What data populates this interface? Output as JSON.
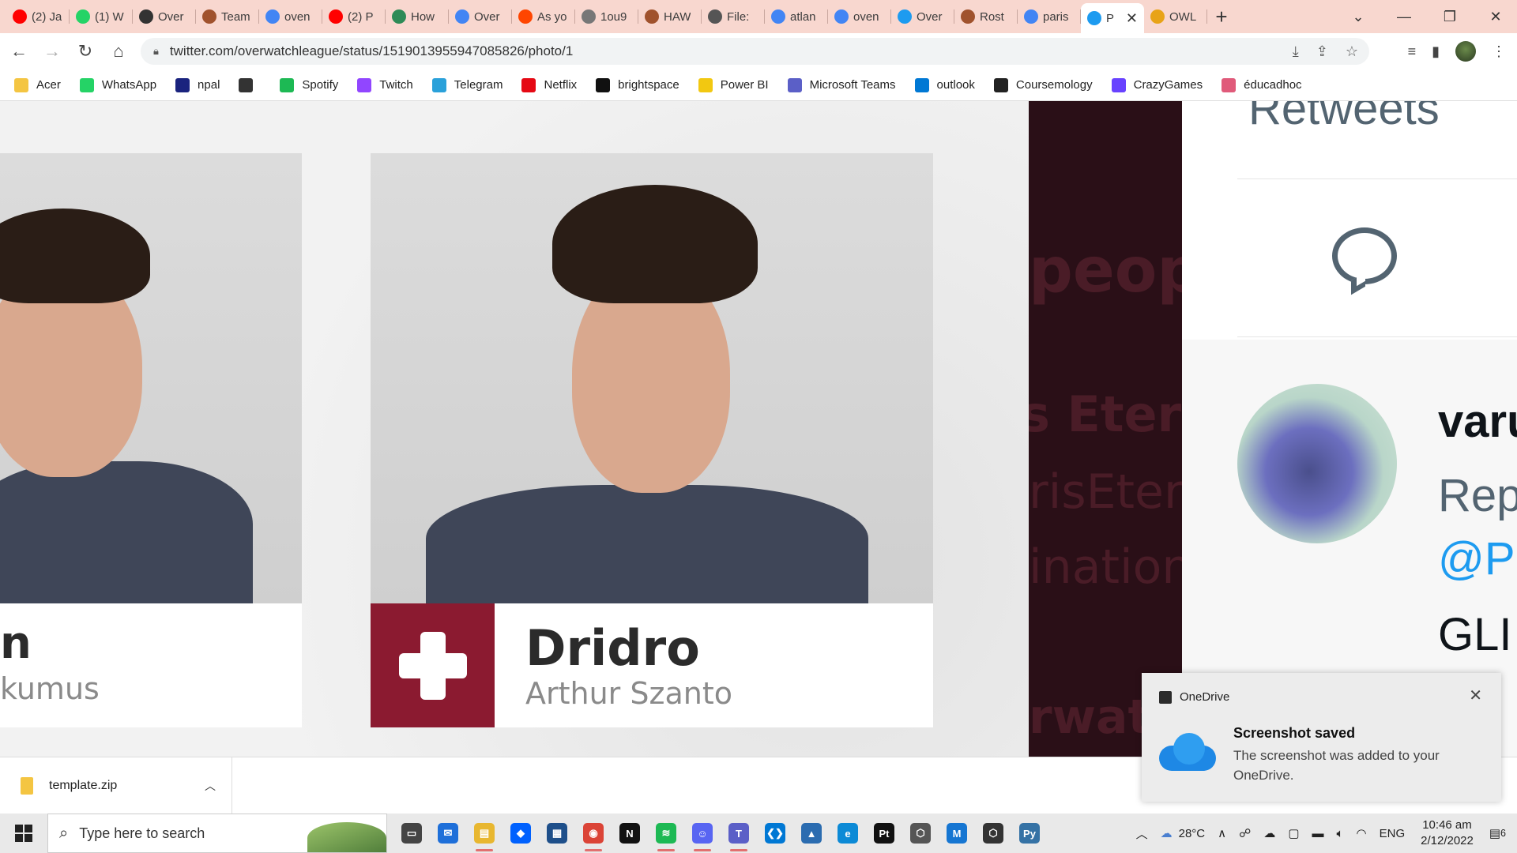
{
  "browser": {
    "tabs": [
      {
        "title": "(2) Ja",
        "icon": "youtube-icon",
        "color": "#ff0000"
      },
      {
        "title": "(1) W",
        "icon": "whatsapp-icon",
        "color": "#25d366"
      },
      {
        "title": "Over",
        "icon": "overwatch-icon",
        "color": "#333333"
      },
      {
        "title": "Team",
        "icon": "team-icon",
        "color": "#a0522d"
      },
      {
        "title": "oven",
        "icon": "google-icon",
        "color": "#4285f4"
      },
      {
        "title": "(2) P",
        "icon": "youtube-icon",
        "color": "#ff0000"
      },
      {
        "title": "How",
        "icon": "wikihow-icon",
        "color": "#2e8b57"
      },
      {
        "title": "Over",
        "icon": "google-icon",
        "color": "#4285f4"
      },
      {
        "title": "As yo",
        "icon": "reddit-icon",
        "color": "#ff4500"
      },
      {
        "title": "1ou9",
        "icon": "globe-icon",
        "color": "#777777"
      },
      {
        "title": "HAW",
        "icon": "team-icon",
        "color": "#a0522d"
      },
      {
        "title": "File:",
        "icon": "wiki-icon",
        "color": "#555555"
      },
      {
        "title": "atlan",
        "icon": "google-icon",
        "color": "#4285f4"
      },
      {
        "title": "oven",
        "icon": "google-icon",
        "color": "#4285f4"
      },
      {
        "title": "Over",
        "icon": "twitter-icon",
        "color": "#1d9bf0"
      },
      {
        "title": "Rost",
        "icon": "team-icon",
        "color": "#a0522d"
      },
      {
        "title": "paris",
        "icon": "google-icon",
        "color": "#4285f4"
      },
      {
        "title": "P",
        "icon": "twitter-icon",
        "color": "#1d9bf0",
        "active": true
      },
      {
        "title": "OWL",
        "icon": "owl-icon",
        "color": "#e8a317"
      }
    ],
    "url": "twitter.com/overwatchleague/status/1519013955947085826/photo/1",
    "bookmarks": [
      {
        "label": "Acer",
        "icon": "folder-icon",
        "color": "#f4c542"
      },
      {
        "label": "WhatsApp",
        "icon": "whatsapp-icon",
        "color": "#25d366"
      },
      {
        "label": "npal",
        "icon": "npal-icon",
        "color": "#1a237e"
      },
      {
        "label": "",
        "icon": "globe-icon",
        "color": "#333333"
      },
      {
        "label": "Spotify",
        "icon": "spotify-icon",
        "color": "#1db954"
      },
      {
        "label": "Twitch",
        "icon": "twitch-icon",
        "color": "#9146ff"
      },
      {
        "label": "Telegram",
        "icon": "telegram-icon",
        "color": "#2aa1da"
      },
      {
        "label": "Netflix",
        "icon": "netflix-icon",
        "color": "#e50914"
      },
      {
        "label": "brightspace",
        "icon": "np-icon",
        "color": "#111111"
      },
      {
        "label": "Power BI",
        "icon": "powerbi-icon",
        "color": "#f2c811"
      },
      {
        "label": "Microsoft Teams",
        "icon": "teams-icon",
        "color": "#5b5fc7"
      },
      {
        "label": "outlook",
        "icon": "outlook-icon",
        "color": "#0078d4"
      },
      {
        "label": "Coursemology",
        "icon": "coursemology-icon",
        "color": "#222222"
      },
      {
        "label": "CrazyGames",
        "icon": "crazygames-icon",
        "color": "#6842ff"
      },
      {
        "label": "éducadhoc",
        "icon": "educadhoc-icon",
        "color": "#e05a7a"
      }
    ]
  },
  "viewer": {
    "left_card": {
      "handle": "n",
      "realname": "kumus"
    },
    "main_card": {
      "handle": "Dridro",
      "realname": "Arthur Szanto",
      "logo_color": "#8b1a30"
    },
    "ghost_text": [
      "peop",
      "s Etern",
      "risEtern",
      "ination",
      "rwatc"
    ]
  },
  "tweet_panel": {
    "retweets_count": "",
    "retweets_label": "Retweets",
    "reply": {
      "user": "varu",
      "replying_to": "Rep",
      "mention": "@Pa",
      "text": "GLI"
    }
  },
  "downloads": {
    "file": "template.zip"
  },
  "toast": {
    "app": "OneDrive",
    "title": "Screenshot saved",
    "message": "The screenshot was added to your OneDrive."
  },
  "taskbar": {
    "search_placeholder": "Type here to search",
    "weather": "28°C",
    "lang": "ENG",
    "time": "10:46 am",
    "date": "2/12/2022",
    "notifications": "6",
    "apps": [
      {
        "name": "task-view-icon",
        "color": "#444444",
        "glyph": "▭"
      },
      {
        "name": "mail-icon",
        "color": "#1e6fd9",
        "glyph": "✉"
      },
      {
        "name": "file-explorer-icon",
        "color": "#e8b730",
        "glyph": "▤",
        "running": true
      },
      {
        "name": "dropbox-icon",
        "color": "#0061fe",
        "glyph": "◆"
      },
      {
        "name": "app-icon",
        "color": "#1e4f8a",
        "glyph": "▦"
      },
      {
        "name": "chrome-icon",
        "color": "#db4437",
        "glyph": "◉",
        "running": true
      },
      {
        "name": "netflix-icon",
        "color": "#111111",
        "glyph": "N"
      },
      {
        "name": "spotify-icon",
        "color": "#1db954",
        "glyph": "≋",
        "running": true
      },
      {
        "name": "discord-icon",
        "color": "#5865f2",
        "glyph": "☺",
        "running": true
      },
      {
        "name": "teams-icon",
        "color": "#5b5fc7",
        "glyph": "T",
        "running": true
      },
      {
        "name": "vscode-icon",
        "color": "#0078d4",
        "glyph": "❮❯"
      },
      {
        "name": "photos-icon",
        "color": "#2b6cb0",
        "glyph": "▲"
      },
      {
        "name": "edge-icon",
        "color": "#0c8ad6",
        "glyph": "e"
      },
      {
        "name": "pycharm-icon",
        "color": "#111111",
        "glyph": "Pt"
      },
      {
        "name": "unity-icon",
        "color": "#555555",
        "glyph": "⬡"
      },
      {
        "name": "app-m-icon",
        "color": "#1676d2",
        "glyph": "M"
      },
      {
        "name": "unity-hub-icon",
        "color": "#333333",
        "glyph": "⬡"
      },
      {
        "name": "python-icon",
        "color": "#3572a5",
        "glyph": "Py"
      }
    ]
  }
}
